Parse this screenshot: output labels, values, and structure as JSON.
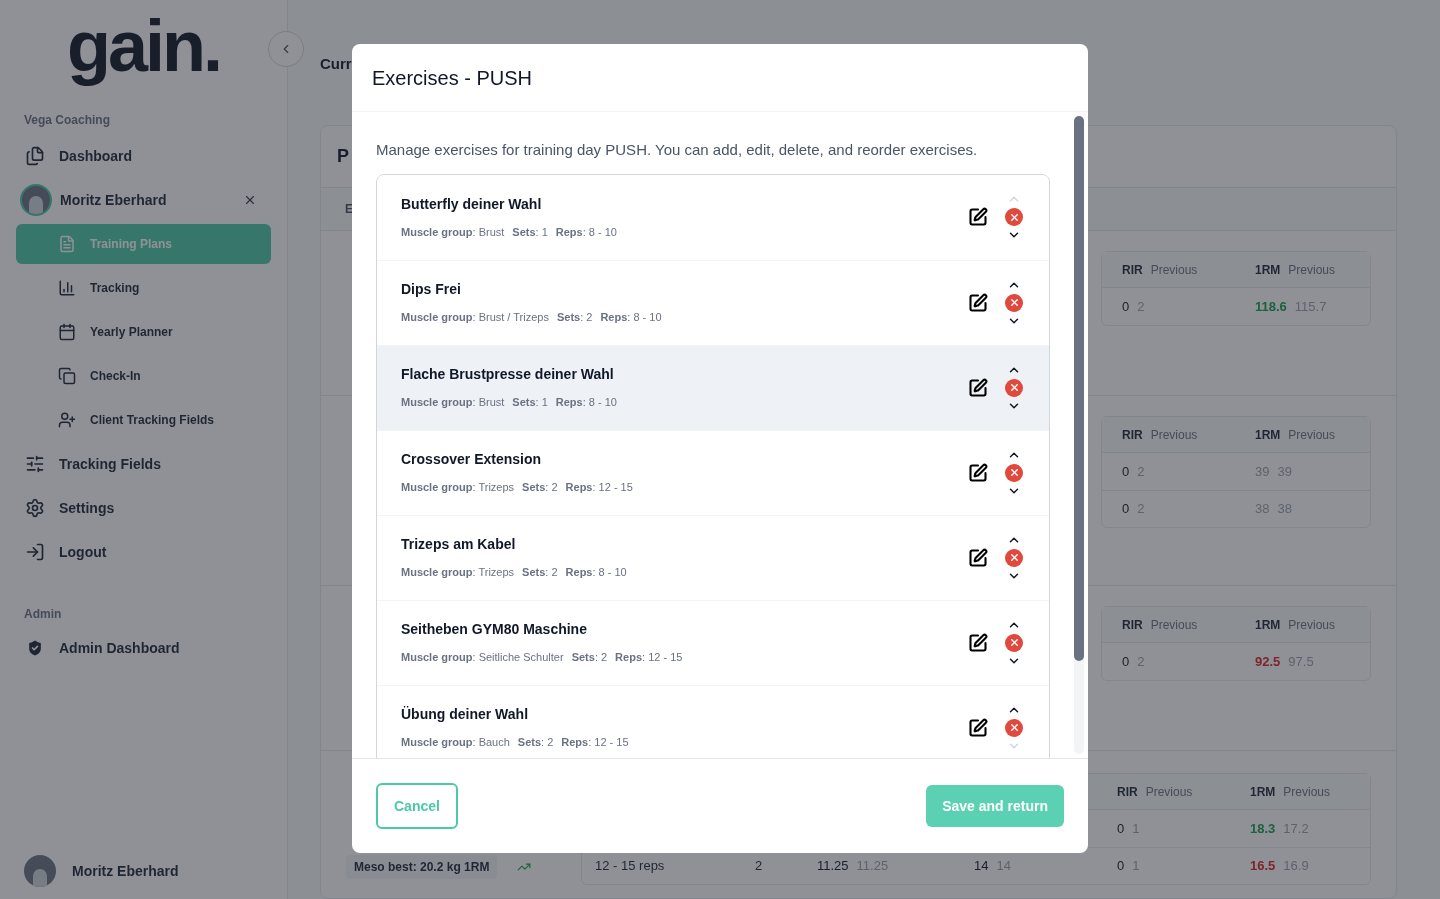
{
  "sidebar": {
    "logo": "gain.",
    "org": "Vega Coaching",
    "items": [
      {
        "kind": "nav",
        "label": "Dashboard"
      },
      {
        "kind": "client",
        "label": "Moritz Eberhard",
        "children": [
          {
            "label": "Training Plans",
            "selected": true
          },
          {
            "label": "Tracking",
            "selected": false
          },
          {
            "label": "Yearly Planner",
            "selected": false
          },
          {
            "label": "Check-In",
            "selected": false
          },
          {
            "label": "Client Tracking Fields",
            "selected": false
          }
        ]
      },
      {
        "kind": "nav",
        "label": "Tracking Fields"
      },
      {
        "kind": "nav",
        "label": "Settings"
      },
      {
        "kind": "nav",
        "label": "Logout"
      }
    ],
    "admin_label": "Admin",
    "admin_items": [
      {
        "label": "Admin Dashboard"
      }
    ],
    "user": {
      "name": "Moritz Eberhard"
    }
  },
  "main": {
    "header_title": "Curr",
    "card_title": "P",
    "card_header": "E",
    "sections": [
      {
        "columns": [
          {
            "label": "RIR",
            "sub": "Previous"
          },
          {
            "label": "1RM",
            "sub": "Previous"
          }
        ],
        "rows": [
          {
            "rir": {
              "value": "0",
              "previous": "2"
            },
            "one_rm": {
              "value": "118.6",
              "previous": "115.7",
              "improved": true,
              "declined": false
            }
          }
        ]
      },
      {
        "columns": [
          {
            "label": "RIR",
            "sub": "Previous"
          },
          {
            "label": "1RM",
            "sub": "Previous"
          }
        ],
        "rows": [
          {
            "rir": {
              "value": "0",
              "previous": "2"
            },
            "one_rm": {
              "value": "39",
              "previous": "39",
              "improved": false,
              "declined": false
            }
          },
          {
            "rir": {
              "value": "0",
              "previous": "2"
            },
            "one_rm": {
              "value": "38",
              "previous": "38",
              "improved": false,
              "declined": false
            }
          }
        ]
      },
      {
        "columns": [
          {
            "label": "RIR",
            "sub": "Previous"
          },
          {
            "label": "1RM",
            "sub": "Previous"
          }
        ],
        "rows": [
          {
            "rir": {
              "value": "0",
              "previous": "2"
            },
            "one_rm": {
              "value": "92.5",
              "previous": "97.5",
              "improved": false,
              "declined": true
            }
          }
        ]
      },
      {
        "columns": [
          {
            "label": "RIR",
            "sub": "Previous"
          },
          {
            "label": "1RM",
            "sub": "Previous"
          }
        ],
        "rows": [
          {
            "rir": {
              "value": "0",
              "previous": "1"
            },
            "one_rm": {
              "value": "18.3",
              "previous": "17.2",
              "improved": true,
              "declined": false
            }
          },
          {
            "rir": {
              "value": "0",
              "previous": "1"
            },
            "one_rm": {
              "value": "16.5",
              "previous": "16.9",
              "improved": false,
              "declined": true
            },
            "lead": {
              "reps": "12 - 15 reps",
              "sets": "2",
              "weight": {
                "value": "11.25",
                "previous": "11.25"
              },
              "reps_done": {
                "value": "14",
                "previous": "14"
              }
            }
          }
        ],
        "meso_best": "Meso best: 20.2 kg 1RM"
      }
    ]
  },
  "modal": {
    "title": "Exercises - PUSH",
    "description": "Manage exercises for training day PUSH. You can add, edit, delete, and reorder exercises.",
    "exercises": [
      {
        "name": "Butterfly deiner Wahl",
        "details": [
          "**Muscle group**: Brust",
          "**Sets**: 1",
          "**Reps**: 8 - 10"
        ],
        "highlighted": false,
        "up_disabled": true,
        "down_disabled": false
      },
      {
        "name": "Dips Frei",
        "details": [
          "**Muscle group**: Brust / Trizeps",
          "**Sets**: 2",
          "**Reps**: 8 - 10"
        ],
        "highlighted": false,
        "up_disabled": false,
        "down_disabled": false
      },
      {
        "name": "Flache Brustpresse deiner Wahl",
        "details": [
          "**Muscle group**: Brust",
          "**Sets**: 1",
          "**Reps**: 8 - 10"
        ],
        "highlighted": true,
        "up_disabled": false,
        "down_disabled": false
      },
      {
        "name": "Crossover Extension",
        "details": [
          "**Muscle group**: Trizeps",
          "**Sets**: 2",
          "**Reps**: 12 - 15"
        ],
        "highlighted": false,
        "up_disabled": false,
        "down_disabled": false
      },
      {
        "name": "Trizeps am Kabel",
        "details": [
          "**Muscle group**: Trizeps",
          "**Sets**: 2",
          "**Reps**: 8 - 10"
        ],
        "highlighted": false,
        "up_disabled": false,
        "down_disabled": false
      },
      {
        "name": "Seitheben GYM80 Maschine",
        "details": [
          "**Muscle group**: Seitliche Schulter",
          "**Sets**: 2",
          "**Reps**: 12 - 15"
        ],
        "highlighted": false,
        "up_disabled": false,
        "down_disabled": false
      },
      {
        "name": "Übung deiner Wahl",
        "details": [
          "**Muscle group**: Bauch",
          "**Sets**: 2",
          "**Reps**: 12 - 15"
        ],
        "highlighted": false,
        "up_disabled": false,
        "down_disabled": true
      }
    ],
    "cancel": "Cancel",
    "save": "Save and return"
  }
}
